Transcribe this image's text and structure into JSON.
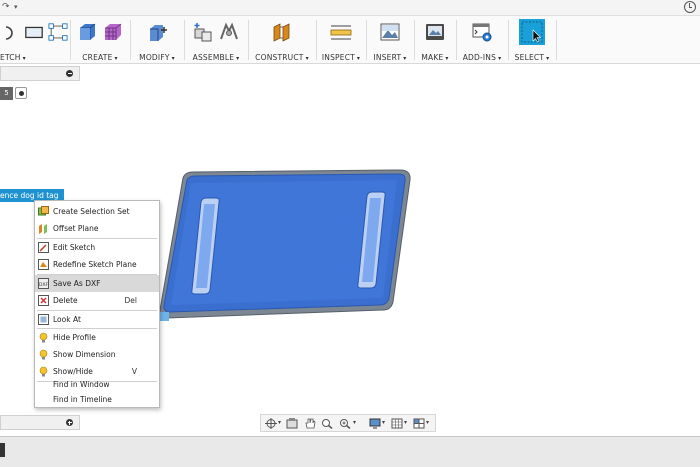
{
  "ribbon": {
    "groups": [
      {
        "id": "sketch",
        "label": "ETCH"
      },
      {
        "id": "create",
        "label": "CREATE"
      },
      {
        "id": "modify",
        "label": "MODIFY"
      },
      {
        "id": "assemble",
        "label": "ASSEMBLE"
      },
      {
        "id": "construct",
        "label": "CONSTRUCT"
      },
      {
        "id": "inspect",
        "label": "INSPECT"
      },
      {
        "id": "insert",
        "label": "INSERT"
      },
      {
        "id": "make",
        "label": "MAKE"
      },
      {
        "id": "addins",
        "label": "ADD-INS"
      },
      {
        "id": "select",
        "label": "SELECT"
      }
    ],
    "caret": "▾"
  },
  "browser": {
    "number_badge": "5",
    "selected_item": "ence dog id tag"
  },
  "context_menu": {
    "items": [
      {
        "label": "Create Selection Set",
        "icon": "selection-set-icon"
      },
      {
        "label": "Offset Plane",
        "icon": "offset-plane-icon"
      },
      {
        "label": "Edit Sketch",
        "icon": "edit-sketch-icon"
      },
      {
        "label": "Redefine Sketch Plane",
        "icon": "redefine-plane-icon"
      },
      {
        "label": "Save As DXF",
        "icon": "dxf-icon"
      },
      {
        "label": "Delete",
        "shortcut": "Del",
        "icon": "delete-icon"
      },
      {
        "label": "Look At",
        "icon": "look-at-icon"
      },
      {
        "label": "Hide Profile",
        "icon": "bulb-icon"
      },
      {
        "label": "Show Dimension",
        "icon": "bulb-icon"
      },
      {
        "label": "Show/Hide",
        "shortcut": "V",
        "icon": "bulb-icon"
      },
      {
        "label": "Find in Window"
      },
      {
        "label": "Find in Timeline"
      }
    ]
  },
  "colors": {
    "accent": "#1f93d1",
    "part_fill": "#3a6fd0",
    "part_edge": "#8a8a8a",
    "slot_fill": "#7fa9ee"
  }
}
